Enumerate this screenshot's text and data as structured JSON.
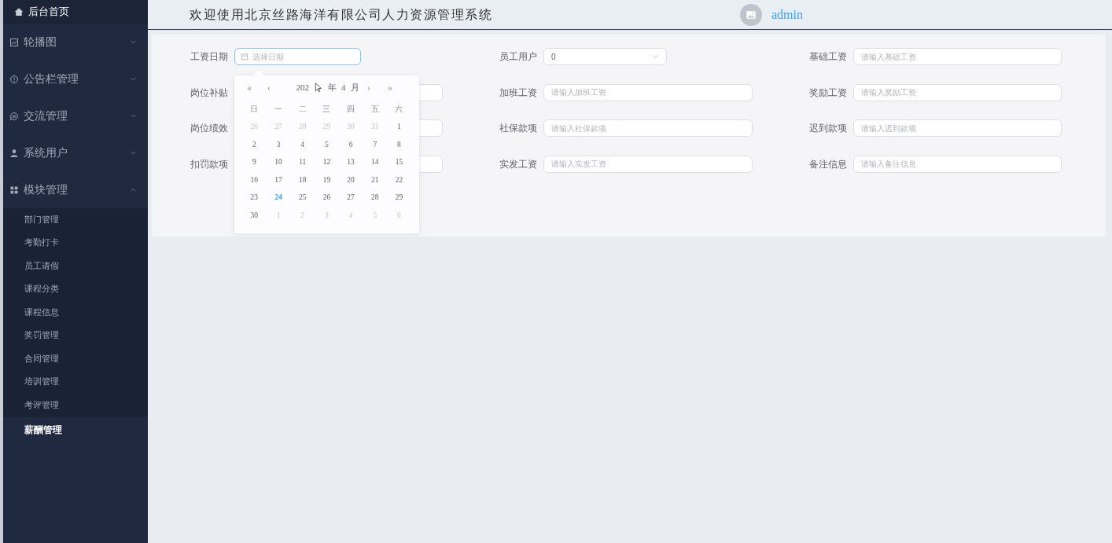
{
  "sidebar": {
    "home": "后台首页",
    "menus": [
      {
        "label": "轮播图",
        "expanded": false
      },
      {
        "label": "公告栏管理",
        "expanded": false
      },
      {
        "label": "交流管理",
        "expanded": false
      },
      {
        "label": "系统用户",
        "expanded": false
      },
      {
        "label": "模块管理",
        "expanded": true,
        "children": [
          {
            "label": "部门管理",
            "selected": false
          },
          {
            "label": "考勤打卡",
            "selected": false
          },
          {
            "label": "员工请假",
            "selected": false
          },
          {
            "label": "课程分类",
            "selected": false
          },
          {
            "label": "课程信息",
            "selected": false
          },
          {
            "label": "奖罚管理",
            "selected": false
          },
          {
            "label": "合同管理",
            "selected": false
          },
          {
            "label": "培训管理",
            "selected": false
          },
          {
            "label": "考评管理",
            "selected": false
          },
          {
            "label": "薪酬管理",
            "selected": true
          }
        ]
      }
    ]
  },
  "header": {
    "title": "欢迎使用北京丝路海洋有限公司人力资源管理系统",
    "user": "admin"
  },
  "form": {
    "fields": [
      {
        "label": "工资日期",
        "kind": "date",
        "placeholder": "选择日期",
        "focused": true
      },
      {
        "label": "员工用户",
        "kind": "select",
        "value": "0",
        "focused": false
      },
      {
        "label": "基础工资",
        "kind": "text",
        "placeholder": "请输入基础工资",
        "focused": false
      },
      {
        "label": "岗位补贴",
        "kind": "text",
        "focused": false
      },
      {
        "label": "加班工资",
        "kind": "text",
        "placeholder": "请输入加班工资",
        "focused": false
      },
      {
        "label": "奖励工资",
        "kind": "text",
        "placeholder": "请输入奖励工资",
        "focused": false
      },
      {
        "label": "岗位绩效",
        "kind": "text",
        "focused": false
      },
      {
        "label": "社保款项",
        "kind": "text",
        "placeholder": "请输入社保款项",
        "focused": false
      },
      {
        "label": "迟到款项",
        "kind": "text",
        "placeholder": "请输入迟到款项",
        "focused": false
      },
      {
        "label": "扣罚款项",
        "kind": "text",
        "focused": false
      },
      {
        "label": "实发工资",
        "kind": "text",
        "placeholder": "请输入实发工资",
        "focused": false
      },
      {
        "label": "备注信息",
        "kind": "text",
        "placeholder": "请输入备注信息",
        "focused": false
      }
    ]
  },
  "date_picker": {
    "prev_year": "«",
    "prev_month": "‹",
    "year": "202",
    "year_unit": "年",
    "month": "4",
    "month_unit": "月",
    "next_month": "›",
    "next_year": "»",
    "weekdays": [
      "日",
      "一",
      "二",
      "三",
      "四",
      "五",
      "六"
    ],
    "days": [
      {
        "day": "26",
        "in_month": false,
        "today": false
      },
      {
        "day": "27",
        "in_month": false,
        "today": false
      },
      {
        "day": "28",
        "in_month": false,
        "today": false
      },
      {
        "day": "29",
        "in_month": false,
        "today": false
      },
      {
        "day": "30",
        "in_month": false,
        "today": false
      },
      {
        "day": "31",
        "in_month": false,
        "today": false
      },
      {
        "day": "1",
        "in_month": true,
        "today": false
      },
      {
        "day": "2",
        "in_month": true,
        "today": false
      },
      {
        "day": "3",
        "in_month": true,
        "today": false
      },
      {
        "day": "4",
        "in_month": true,
        "today": false
      },
      {
        "day": "5",
        "in_month": true,
        "today": false
      },
      {
        "day": "6",
        "in_month": true,
        "today": false
      },
      {
        "day": "7",
        "in_month": true,
        "today": false
      },
      {
        "day": "8",
        "in_month": true,
        "today": false
      },
      {
        "day": "9",
        "in_month": true,
        "today": false
      },
      {
        "day": "10",
        "in_month": true,
        "today": false
      },
      {
        "day": "11",
        "in_month": true,
        "today": false
      },
      {
        "day": "12",
        "in_month": true,
        "today": false
      },
      {
        "day": "13",
        "in_month": true,
        "today": false
      },
      {
        "day": "14",
        "in_month": true,
        "today": false
      },
      {
        "day": "15",
        "in_month": true,
        "today": false
      },
      {
        "day": "16",
        "in_month": true,
        "today": false
      },
      {
        "day": "17",
        "in_month": true,
        "today": false
      },
      {
        "day": "18",
        "in_month": true,
        "today": false
      },
      {
        "day": "19",
        "in_month": true,
        "today": false
      },
      {
        "day": "20",
        "in_month": true,
        "today": false
      },
      {
        "day": "21",
        "in_month": true,
        "today": false
      },
      {
        "day": "22",
        "in_month": true,
        "today": false
      },
      {
        "day": "23",
        "in_month": true,
        "today": false
      },
      {
        "day": "24",
        "in_month": true,
        "today": true
      },
      {
        "day": "25",
        "in_month": true,
        "today": false
      },
      {
        "day": "26",
        "in_month": true,
        "today": false
      },
      {
        "day": "27",
        "in_month": true,
        "today": false
      },
      {
        "day": "28",
        "in_month": true,
        "today": false
      },
      {
        "day": "29",
        "in_month": true,
        "today": false
      },
      {
        "day": "30",
        "in_month": true,
        "today": false
      },
      {
        "day": "1",
        "in_month": false,
        "today": false
      },
      {
        "day": "2",
        "in_month": false,
        "today": false
      },
      {
        "day": "3",
        "in_month": false,
        "today": false
      },
      {
        "day": "4",
        "in_month": false,
        "today": false
      },
      {
        "day": "5",
        "in_month": false,
        "today": false
      },
      {
        "day": "6",
        "in_month": false,
        "today": false
      }
    ]
  }
}
